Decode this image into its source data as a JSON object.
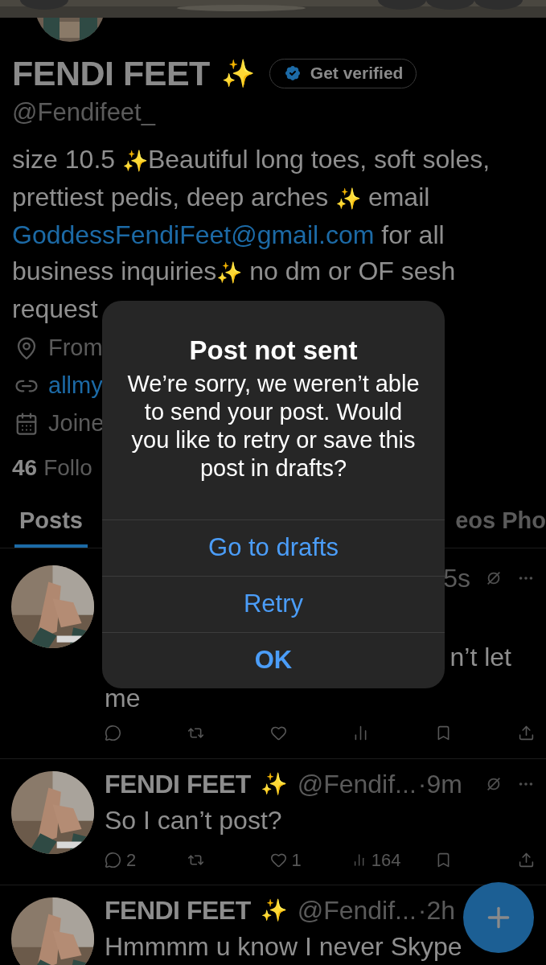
{
  "profile": {
    "name": "FENDI FEET",
    "name_emoji": "✨",
    "verify_button": "Get verified",
    "handle": "@Fendifeet_",
    "bio": [
      {
        "kind": "text",
        "text": "size 10.5 "
      },
      {
        "kind": "sparkle",
        "text": "✨"
      },
      {
        "kind": "text",
        "text": "Beautiful long toes, soft soles, prettiest pedis, deep arches "
      },
      {
        "kind": "sparkle",
        "text": "✨"
      },
      {
        "kind": "text",
        "text": " email "
      },
      {
        "kind": "link",
        "text": "GoddessFendiFeet@gmail.com"
      },
      {
        "kind": "text",
        "text": " for all business inquiries"
      },
      {
        "kind": "sparkle",
        "text": "✨"
      },
      {
        "kind": "text",
        "text": " no dm or OF sesh request"
      }
    ],
    "meta": [
      {
        "kind": "location",
        "text": "From"
      },
      {
        "kind": "website",
        "text": "allmy"
      },
      {
        "kind": "joined",
        "text": "Joine"
      }
    ],
    "following_count": "46",
    "following_label": "Follo"
  },
  "tabs": [
    {
      "label": "Posts",
      "selected": true
    },
    {
      "label": "eos",
      "selected": false
    },
    {
      "label": "Pho",
      "selected": false
    }
  ],
  "posts": [
    {
      "time": "5s",
      "lines": [
        "n’t let",
        "me"
      ],
      "actions": [
        {
          "kind": "reply"
        },
        {
          "kind": "repost"
        },
        {
          "kind": "like"
        },
        {
          "kind": "views"
        },
        {
          "kind": "bookmark"
        },
        {
          "kind": "share"
        }
      ]
    },
    {
      "name": "FENDI FEET",
      "name_emoji": "✨",
      "handle": "@Fendif...",
      "time": "·9m",
      "lines": [
        "So I can’t post?"
      ],
      "actions": [
        {
          "kind": "reply",
          "count": "2"
        },
        {
          "kind": "repost"
        },
        {
          "kind": "like",
          "count": "1"
        },
        {
          "kind": "views",
          "count": "164"
        },
        {
          "kind": "bookmark"
        },
        {
          "kind": "share"
        }
      ]
    },
    {
      "name": "FENDI FEET",
      "name_emoji": "✨",
      "handle": "@Fendif...",
      "time": "·2h",
      "lines": [
        "Hmmmm u know I never Skype"
      ]
    }
  ],
  "dialog": {
    "title": "Post not sent",
    "message": "We’re sorry, we weren’t able to send your post. Would you like to retry or save this post in drafts?",
    "buttons": [
      {
        "label": "Go to drafts",
        "kind": "default"
      },
      {
        "label": "Retry",
        "kind": "default"
      },
      {
        "label": "OK",
        "kind": "preferred"
      }
    ]
  }
}
